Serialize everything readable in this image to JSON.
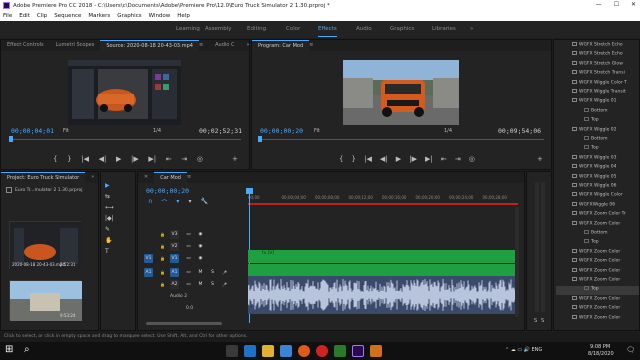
{
  "window": {
    "title": "Adobe Premiere Pro CC 2018 - C:\\Users\\c\\Documents\\Adobe\\Premiere Pro\\12.0\\Euro Truck Simulator 2 1.30.prproj *",
    "min": "—",
    "max": "☐",
    "close": "✕"
  },
  "menu": [
    "File",
    "Edit",
    "Clip",
    "Sequence",
    "Markers",
    "Graphics",
    "Window",
    "Help"
  ],
  "workspaces": [
    "Learning",
    "Assembly",
    "Editing",
    "Color",
    "Effects",
    "Audio",
    "Graphics",
    "Libraries"
  ],
  "workspace_more": "»",
  "source_panel": {
    "tabs": [
      "Effect Controls",
      "Lumetri Scopes",
      "Source: 2020-08-18 20-43-03.mp4",
      "Audio C"
    ],
    "tab_menu": "≡",
    "more": "»",
    "timecode": "00;00;04;01",
    "fit": "Fit",
    "fraction": "1/4",
    "duration": "00;02;52;31"
  },
  "program_panel": {
    "tab": "Program: Car Mod",
    "tab_menu": "≡",
    "timecode": "00;00;00;20",
    "fit": "Fit",
    "fraction": "1/4",
    "duration": "00;09;54;06"
  },
  "controls": {
    "mark_in": "{",
    "mark_out": "}",
    "go_in": "|◀",
    "step_back": "◀|",
    "play": "▶",
    "step_fwd": "|▶",
    "go_out": "▶|",
    "insert": "⇤",
    "overwrite": "⇥",
    "export_frame": "◎",
    "add": "+",
    "marker": "▾"
  },
  "project_panel": {
    "tab": "Project: Euro Truck Simulator",
    "more": "»",
    "filename": "Euro Tr...mulator 2 1.30.prproj",
    "clip1_name": "2020-08-18 20-43-03.mp4",
    "clip1_duration": "2:52:31",
    "clip2_duration": "9:53:24"
  },
  "tools": [
    "▶",
    "⇆",
    "⟷",
    "|◆|",
    "✎",
    "✋",
    "T"
  ],
  "timeline": {
    "close": "✕",
    "tab": "Car Mod",
    "tab_menu": "≡",
    "timecode": "00;00;00;20",
    "ruler": [
      "00;00",
      "00;00;04;00",
      "00;00;08;00",
      "00;00;12;00",
      "00;00;16;00",
      "00;00;20;00",
      "00;00;24;00",
      "00;00;28;00"
    ],
    "tracks": [
      {
        "name": "V3",
        "src": ""
      },
      {
        "name": "V2",
        "src": ""
      },
      {
        "name": "V1",
        "src": "V1"
      },
      {
        "name": "A1",
        "src": "A1"
      },
      {
        "name": "A2",
        "src": ""
      }
    ],
    "audio2_label": "Audio 2",
    "clip_label": "fx [V]",
    "toggles": {
      "lock": "🔒",
      "sync": "▭",
      "eye": "◉",
      "mute": "M",
      "solo": "S",
      "mic": "🎤"
    },
    "mix_values": [
      "0.0",
      "⊕"
    ],
    "header_icons": {
      "snap": "∩",
      "linked": "⌒",
      "marker": "▾",
      "wrench": "🔧"
    },
    "meter_labels": [
      "S",
      "S"
    ]
  },
  "effects_list": [
    "WGFX Stretch Echo",
    "WGFX Stretch Echo",
    "WGFX Stretch Glow",
    "WGFX Stretch Transi",
    "WGFX Wiggle Color T",
    "WGFX Wiggle Transit",
    "WGFX Wiggle 01",
    "Bottom",
    "Top",
    "WGFX Wiggle 02",
    "Bottom",
    "Top",
    "WGFX Wiggle 03",
    "WGFX Wiggle 04",
    "WGFX Wiggle 05",
    "WGFX Wiggle 06",
    "WGFX Wiggle Color",
    "WGFXWiggle 06",
    "WGFX Zoom Color Tr",
    "WGFX Zoom Color",
    "Bottom",
    "Top",
    "WGFX Zoom Color",
    "WGFX Zoom Color",
    "WGFX Zoom Color",
    "WGFX Zoom Color",
    "Top",
    "WGFX Zoom Color",
    "WGFX Zoom Color",
    "WGFX Zoom Color"
  ],
  "statusbar": "Click to select, or click in empty space and drag to marquee select. Use Shift, Alt, and Ctrl for other options.",
  "taskbar": {
    "start": "⊞",
    "search": "⌕",
    "tray": "⌃  ☁  ▭  🔊  ENG",
    "time": "9:08 PM",
    "date": "8/18/2020",
    "notif": "🗨"
  },
  "colors": {
    "accent": "#4aa8ff",
    "clip_green": "#1ea042",
    "audio_wave": "#a8b8d8",
    "track_blue": "#1f5c9c"
  }
}
